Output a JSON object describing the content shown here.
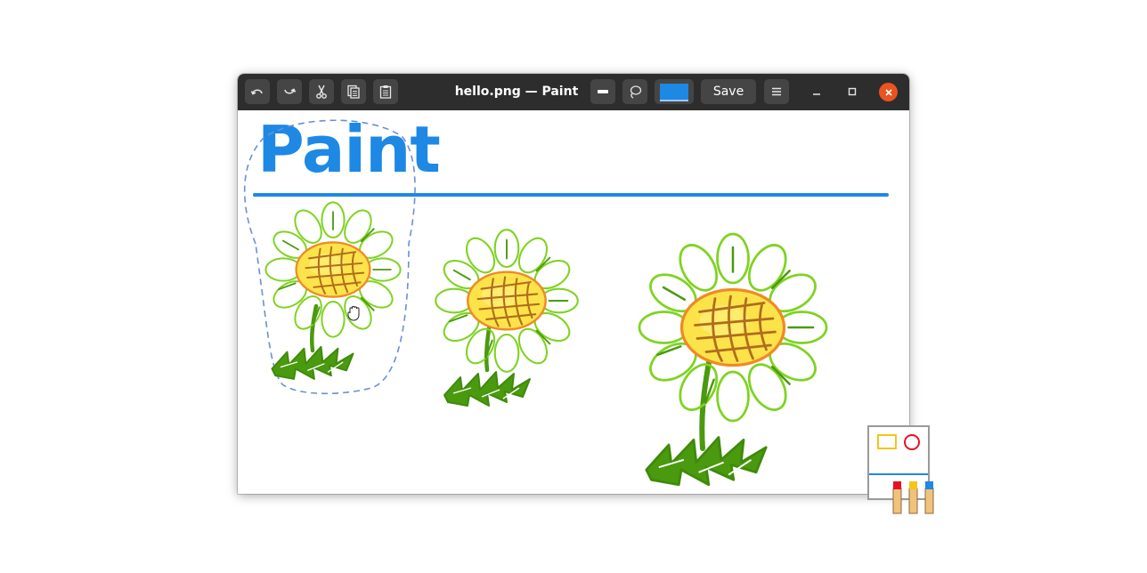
{
  "window": {
    "title": "hello.png — Paint",
    "save_label": "Save"
  },
  "toolbar": {
    "icons": [
      "undo-icon",
      "redo-icon",
      "cut-icon",
      "copy-icon",
      "paste-icon",
      "line-width-icon",
      "lasso-select-icon"
    ],
    "current_color": "#1e88e5"
  },
  "canvas": {
    "heading": "Paint",
    "heading_color": "#1e88e5"
  },
  "colors": {
    "accent": "#1e88e5",
    "close": "#e95420",
    "titlebar": "#2d2d2d"
  }
}
